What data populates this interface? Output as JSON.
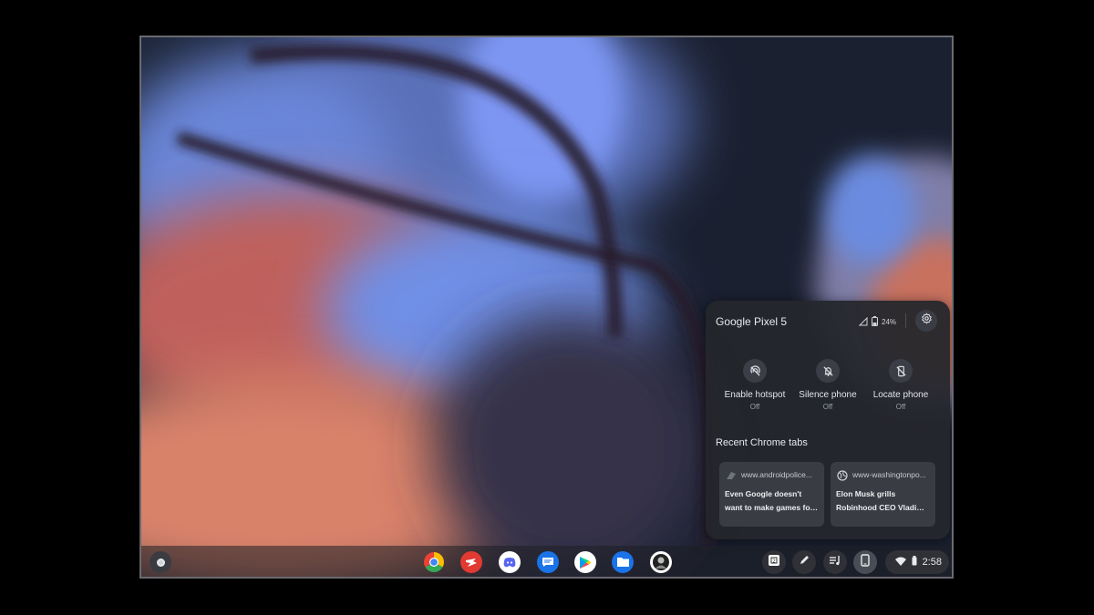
{
  "phone_hub": {
    "device_name": "Google Pixel 5",
    "battery": "24%",
    "features": [
      {
        "label": "Enable hotspot",
        "state": "Off",
        "icon": "hotspot-off-icon"
      },
      {
        "label": "Silence phone",
        "state": "Off",
        "icon": "bell-off-icon"
      },
      {
        "label": "Locate phone",
        "state": "Off",
        "icon": "locate-phone-off-icon"
      }
    ],
    "recent_title": "Recent Chrome tabs",
    "tabs": [
      {
        "url": "www.androidpolice...",
        "title_line1": "Even Google doesn't",
        "title_line2": "want to make games for ..."
      },
      {
        "url": "www-washingtonpo...",
        "title_line1": "Elon Musk grills",
        "title_line2": "Robinhood CEO Vladimi..."
      }
    ]
  },
  "shelf": {
    "apps": [
      "chrome-icon",
      "stadia-icon",
      "discord-icon",
      "messages-icon",
      "play-store-icon",
      "files-icon",
      "avatar-app-icon"
    ],
    "tray": [
      "clipboard-icon",
      "stylus-icon",
      "media-queue-icon",
      "phone-hub-icon"
    ],
    "time": "2:58"
  }
}
